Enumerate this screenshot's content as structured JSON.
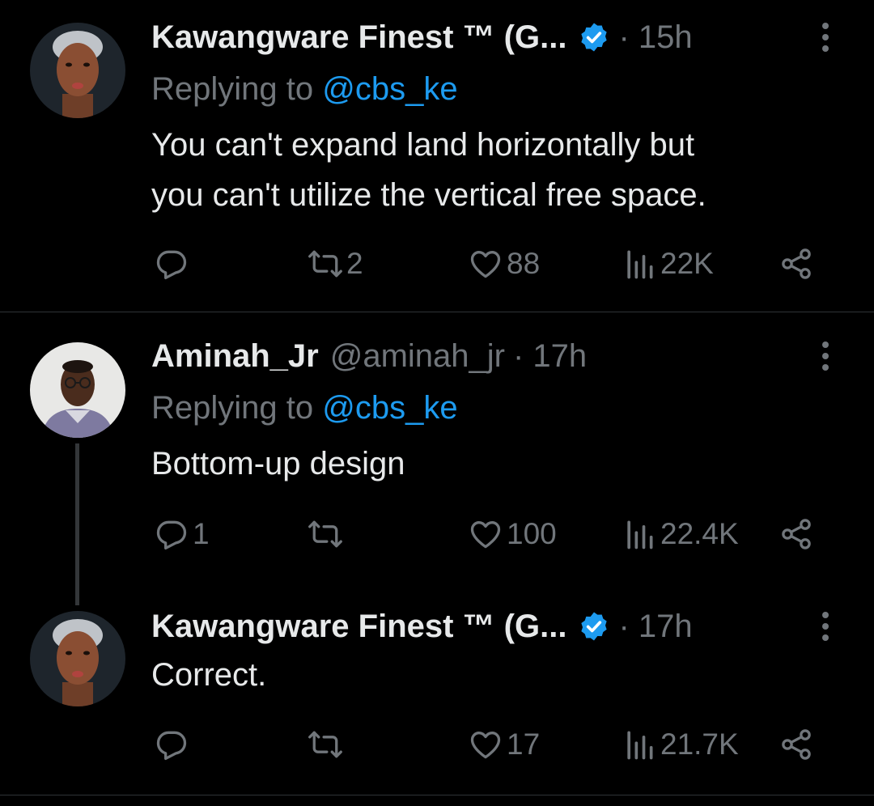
{
  "tweets": [
    {
      "name": "Kawangware Finest ™ (G...",
      "handle": "",
      "time": "· 15h",
      "verified": true,
      "reply_prefix": "Replying to ",
      "reply_handle": "@cbs_ke",
      "text_lines": [
        "You can't expand land horizontally but",
        "you can't utilize the vertical free space."
      ],
      "stats": {
        "replies": "",
        "retweets": "2",
        "likes": "88",
        "views": "22K"
      }
    },
    {
      "name": "Aminah_Jr",
      "handle": "@aminah_jr",
      "time": "· 17h",
      "verified": false,
      "reply_prefix": "Replying to ",
      "reply_handle": "@cbs_ke",
      "text_lines": [
        "Bottom-up design"
      ],
      "stats": {
        "replies": "1",
        "retweets": "",
        "likes": "100",
        "views": "22.4K"
      }
    },
    {
      "name": "Kawangware Finest ™ (G...",
      "handle": "",
      "time": "· 17h",
      "verified": true,
      "text_lines": [
        "Correct."
      ],
      "stats": {
        "replies": "",
        "retweets": "",
        "likes": "17",
        "views": "21.7K"
      }
    }
  ],
  "colors": {
    "background": "#000000",
    "text": "#e7e9ea",
    "muted": "#71767b",
    "link": "#1d9bf0",
    "verified": "#1d9bf0",
    "divider": "#2f3336"
  },
  "icons": [
    "verified-badge-icon",
    "more-options-icon",
    "reply-icon",
    "retweet-icon",
    "like-icon",
    "views-icon",
    "share-icon"
  ]
}
